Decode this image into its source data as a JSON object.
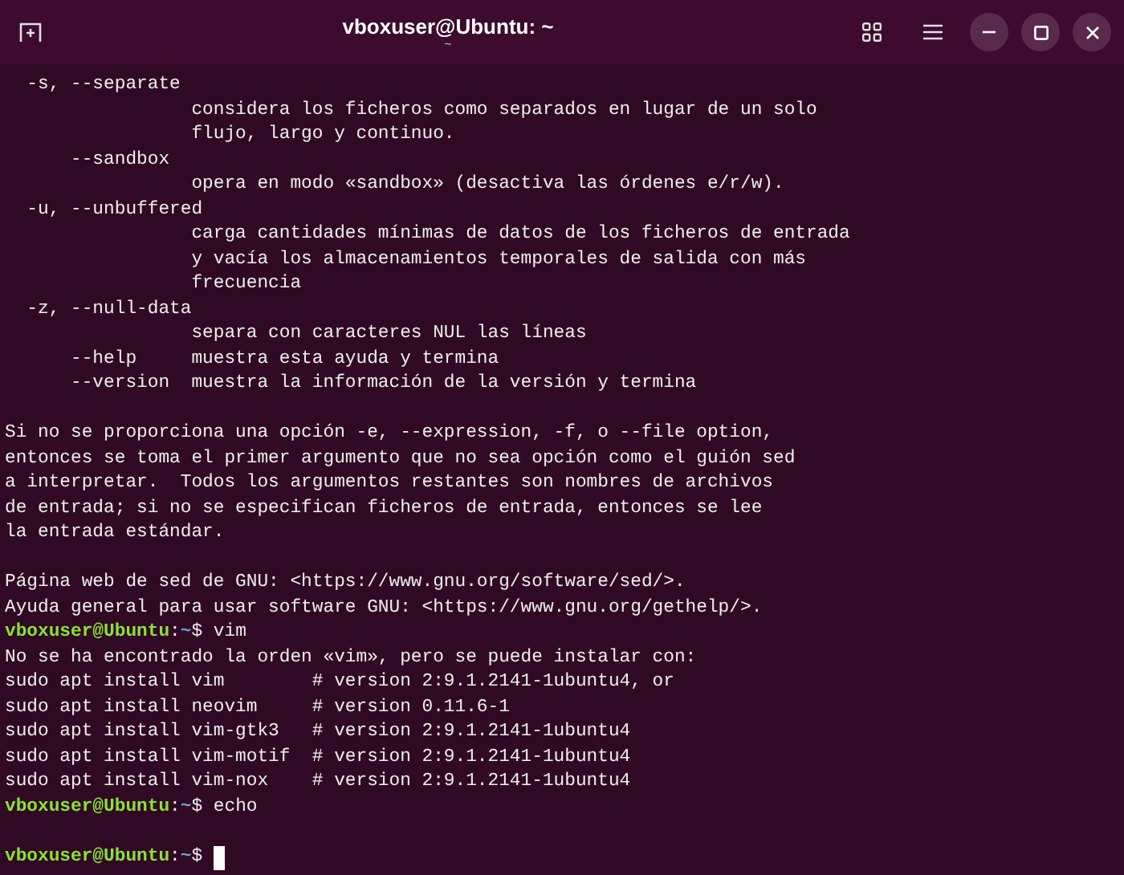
{
  "window": {
    "title": "vboxuser@Ubuntu: ~",
    "subtitle": "~"
  },
  "terminal": {
    "lines": [
      {
        "kind": "output",
        "text": "  -s, --separate"
      },
      {
        "kind": "output",
        "text": "                 considera los ficheros como separados en lugar de un solo"
      },
      {
        "kind": "output",
        "text": "                 flujo, largo y continuo."
      },
      {
        "kind": "output",
        "text": "      --sandbox"
      },
      {
        "kind": "output",
        "text": "                 opera en modo «sandbox» (desactiva las órdenes e/r/w)."
      },
      {
        "kind": "output",
        "text": "  -u, --unbuffered"
      },
      {
        "kind": "output",
        "text": "                 carga cantidades mínimas de datos de los ficheros de entrada"
      },
      {
        "kind": "output",
        "text": "                 y vacía los almacenamientos temporales de salida con más"
      },
      {
        "kind": "output",
        "text": "                 frecuencia"
      },
      {
        "kind": "output",
        "text": "  -z, --null-data"
      },
      {
        "kind": "output",
        "text": "                 separa con caracteres NUL las líneas"
      },
      {
        "kind": "output",
        "text": "      --help     muestra esta ayuda y termina"
      },
      {
        "kind": "output",
        "text": "      --version  muestra la información de la versión y termina"
      },
      {
        "kind": "blank"
      },
      {
        "kind": "output",
        "text": "Si no se proporciona una opción -e, --expression, -f, o --file option,"
      },
      {
        "kind": "output",
        "text": "entonces se toma el primer argumento que no sea opción como el guión sed"
      },
      {
        "kind": "output",
        "text": "a interpretar.  Todos los argumentos restantes son nombres de archivos"
      },
      {
        "kind": "output",
        "text": "de entrada; si no se especifican ficheros de entrada, entonces se lee"
      },
      {
        "kind": "output",
        "text": "la entrada estándar."
      },
      {
        "kind": "blank"
      },
      {
        "kind": "output",
        "text": "Página web de sed de GNU: <https://www.gnu.org/software/sed/>."
      },
      {
        "kind": "output",
        "text": "Ayuda general para usar software GNU: <https://www.gnu.org/gethelp/>."
      },
      {
        "kind": "prompt",
        "user": "vboxuser@Ubuntu",
        "separator": ":",
        "path": "~",
        "symbol": "$",
        "command": "vim",
        "cursor": false
      },
      {
        "kind": "output",
        "text": "No se ha encontrado la orden «vim», pero se puede instalar con:"
      },
      {
        "kind": "output",
        "text": "sudo apt install vim        # version 2:9.1.2141-1ubuntu4, or"
      },
      {
        "kind": "output",
        "text": "sudo apt install neovim     # version 0.11.6-1"
      },
      {
        "kind": "output",
        "text": "sudo apt install vim-gtk3   # version 2:9.1.2141-1ubuntu4"
      },
      {
        "kind": "output",
        "text": "sudo apt install vim-motif  # version 2:9.1.2141-1ubuntu4"
      },
      {
        "kind": "output",
        "text": "sudo apt install vim-nox    # version 2:9.1.2141-1ubuntu4"
      },
      {
        "kind": "prompt",
        "user": "vboxuser@Ubuntu",
        "separator": ":",
        "path": "~",
        "symbol": "$",
        "command": "echo",
        "cursor": false
      },
      {
        "kind": "blank"
      },
      {
        "kind": "prompt",
        "user": "vboxuser@Ubuntu",
        "separator": ":",
        "path": "~",
        "symbol": "$",
        "cursor": true
      }
    ]
  }
}
